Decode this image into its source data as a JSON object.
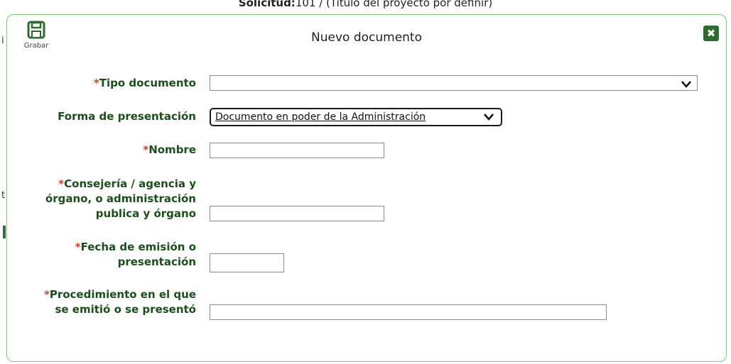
{
  "background": {
    "header_label": "Solicitud:",
    "header_value": "101 / (Titulo del proyecto por definir)"
  },
  "modal": {
    "title": "Nuevo documento",
    "save_label": "Grabar",
    "close_icon": "close-icon",
    "save_icon": "save-icon"
  },
  "form": {
    "tipo_documento": {
      "label": "Tipo documento",
      "required": "*",
      "value": ""
    },
    "forma_presentacion": {
      "label": "Forma de presentación",
      "value": "Documento en poder de la Administración"
    },
    "nombre": {
      "label": "Nombre",
      "required": "*",
      "value": ""
    },
    "consejeria": {
      "label_line1": "Consejería / agencia y",
      "label_line2": "órgano, o administración",
      "label_line3": "publica y órgano",
      "required": "*",
      "value": ""
    },
    "fecha": {
      "label_line1": "Fecha de emisión o",
      "label_line2": "presentación",
      "required": "*",
      "value": ""
    },
    "procedimiento": {
      "label_line1": "Procedimiento en el que",
      "label_line2": "se emitió o se presentó",
      "required": "*",
      "value": ""
    }
  },
  "colors": {
    "label_green": "#1a4e1a",
    "required_red": "#e0382a",
    "modal_border": "#7ec87e",
    "close_bg": "#2e6b2e"
  }
}
